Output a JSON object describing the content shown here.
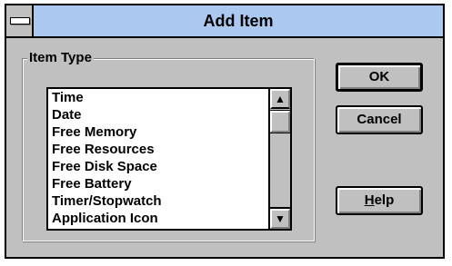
{
  "window": {
    "title": "Add Item"
  },
  "item_type": {
    "group_label": "Item Type",
    "items": [
      "Time",
      "Date",
      "Free Memory",
      "Free Resources",
      "Free Disk Space",
      "Free Battery",
      "Timer/Stopwatch",
      "Application Icon"
    ]
  },
  "buttons": {
    "ok": "OK",
    "cancel": "Cancel",
    "help_mnemonic": "H",
    "help_rest": "elp"
  },
  "icons": {
    "system_menu": "system-menu-icon",
    "scroll_up": "up-arrow-icon",
    "scroll_down": "down-arrow-icon"
  },
  "colors": {
    "titlebar": "#abc9f0",
    "face": "#c0c0c0"
  }
}
